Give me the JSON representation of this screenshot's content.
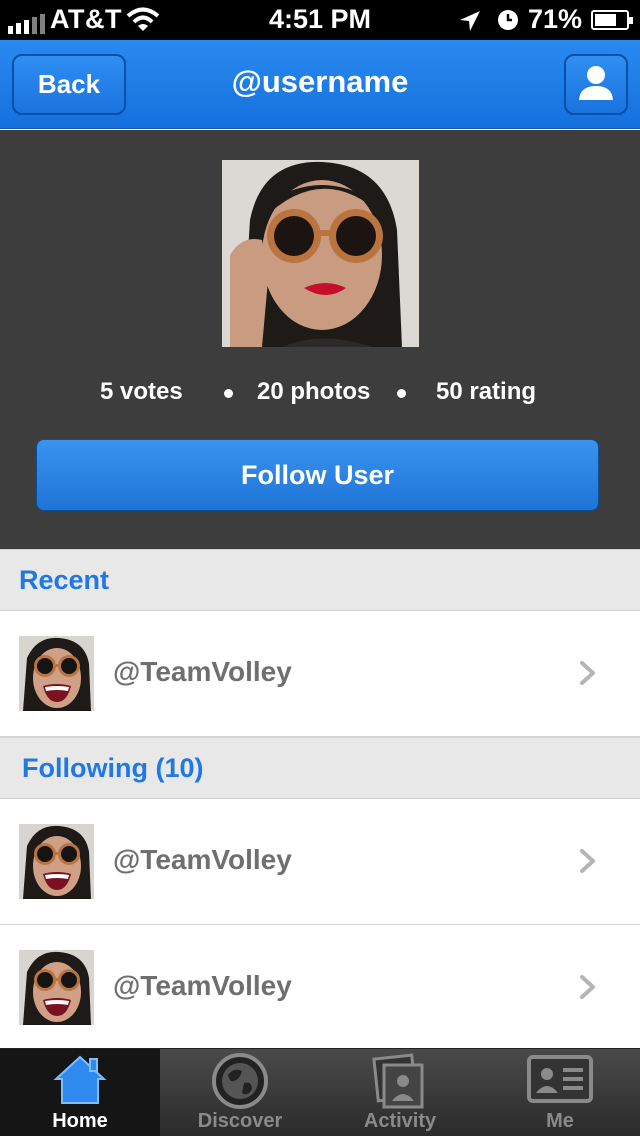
{
  "status_bar": {
    "carrier": "AT&T",
    "time": "4:51 PM",
    "battery_percent": "71%",
    "battery_level": 0.71,
    "icons": [
      "signal-icon",
      "wifi-icon",
      "location-icon",
      "alarm-icon",
      "battery-icon"
    ]
  },
  "navbar": {
    "back_label": "Back",
    "title": "@username",
    "profile_icon": "user-icon"
  },
  "profile": {
    "stats": {
      "votes": "5 votes",
      "photos": "20 photos",
      "rating": "50 rating"
    },
    "follow_label": "Follow User"
  },
  "sections": {
    "recent": {
      "title": "Recent",
      "items": [
        {
          "name": "@TeamVolley"
        }
      ]
    },
    "following": {
      "title": "Following (10)",
      "items": [
        {
          "name": "@TeamVolley"
        },
        {
          "name": "@TeamVolley"
        }
      ]
    }
  },
  "tabbar": {
    "active": "Home",
    "tabs": [
      {
        "label": "Home",
        "icon": "home-icon"
      },
      {
        "label": "Discover",
        "icon": "globe-icon"
      },
      {
        "label": "Activity",
        "icon": "photos-icon"
      },
      {
        "label": "Me",
        "icon": "id-card-icon"
      }
    ]
  },
  "colors": {
    "accent": "#1f78e6",
    "nav_bar": "#1a76e2",
    "profile_bg": "#3d3d3d",
    "section_bg": "#e8e8e8",
    "tabbar_bg": "#333333"
  }
}
